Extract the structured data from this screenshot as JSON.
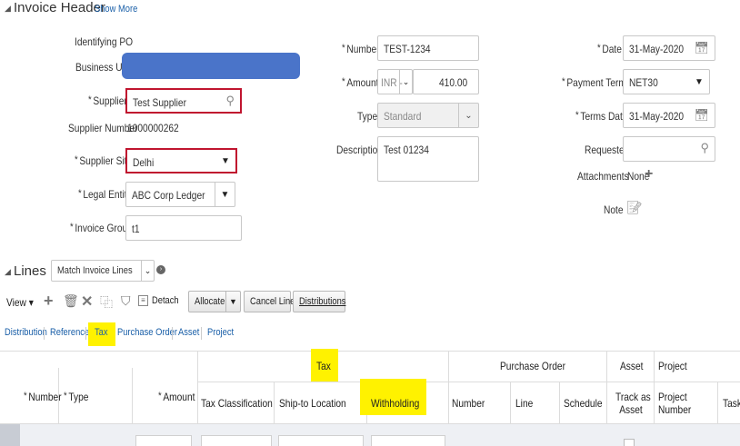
{
  "header": {
    "title": "Invoice Header",
    "show_more": "Show More"
  },
  "left": {
    "identifying_po_label": "Identifying PO",
    "business_unit_label": "Business Unit",
    "supplier_label": "Supplier",
    "supplier_value": "Test Supplier",
    "supplier_number_label": "Supplier Number",
    "supplier_number_value": "1000000262",
    "supplier_site_label": "Supplier Site",
    "supplier_site_value": "Delhi",
    "legal_entity_label": "Legal Entity",
    "legal_entity_value": "ABC Corp Ledger",
    "invoice_group_label": "Invoice Group",
    "invoice_group_value": "t1"
  },
  "middle": {
    "number_label": "Number",
    "number_value": "TEST-1234",
    "amount_label": "Amount",
    "currency_value": "INR -",
    "amount_value": "410.00",
    "type_label": "Type",
    "type_value": "Standard",
    "description_label": "Description",
    "description_value": "Test 01234"
  },
  "right": {
    "date_label": "Date",
    "date_value": "31-May-2020",
    "payment_terms_label": "Payment Terms",
    "payment_terms_value": "NET30",
    "terms_date_label": "Terms Date",
    "terms_date_value": "31-May-2020",
    "requester_label": "Requester",
    "attachments_label": "Attachments",
    "attachments_value": "None",
    "note_label": "Note"
  },
  "lines": {
    "title": "Lines",
    "match_select_value": "Match Invoice Lines",
    "view_label": "View",
    "detach_label": "Detach",
    "allocate_label": "Allocate",
    "cancel_line_label": "Cancel Line",
    "distributions_label": "Distributions"
  },
  "tabs": [
    "Distribution",
    "Reference",
    "Tax",
    "Purchase Order",
    "Asset",
    "Project"
  ],
  "table": {
    "group_tax": "Tax",
    "group_po": "Purchase Order",
    "group_asset": "Asset",
    "group_project": "Project",
    "col_number": "Number",
    "col_type": "Type",
    "col_amount": "Amount",
    "col_tax_classification": "Tax Classification",
    "col_ship_to": "Ship-to Location",
    "col_withholding": "Withholding",
    "col_po_number": "Number",
    "col_line": "Line",
    "col_schedule": "Schedule",
    "col_track_as_asset_1": "Track as",
    "col_track_as_asset_2": "Asset",
    "col_project_number_1": "Project",
    "col_project_number_2": "Number",
    "col_task": "Task"
  },
  "colors": {
    "highlight": "#fff200",
    "required_border": "#c0152f",
    "link": "#1a5fa8",
    "redaction": "#4a74c9"
  }
}
